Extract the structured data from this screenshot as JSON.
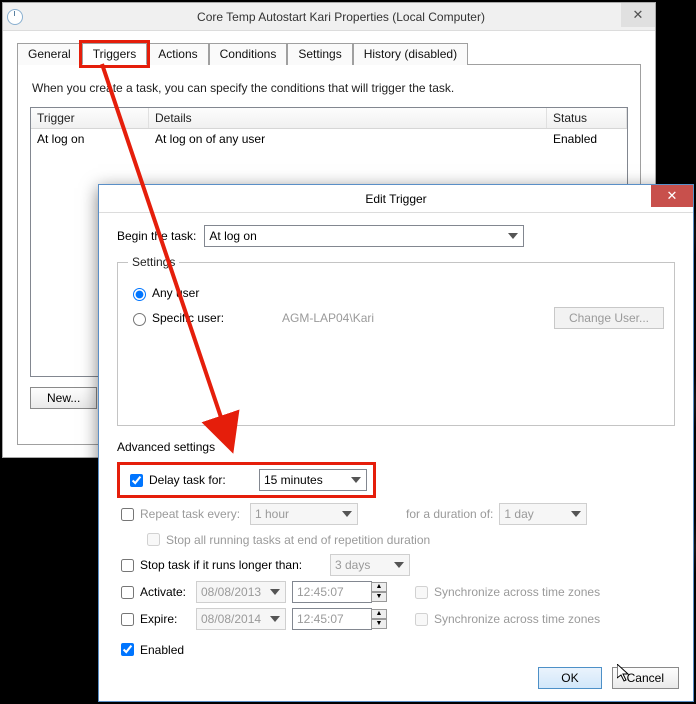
{
  "main_window": {
    "title": "Core Temp Autostart Kari Properties (Local Computer)",
    "close_glyph": "✕",
    "tabs": [
      "General",
      "Triggers",
      "Actions",
      "Conditions",
      "Settings",
      "History (disabled)"
    ],
    "active_tab_index": 1,
    "intro": "When you create a task, you can specify the conditions that will trigger the task.",
    "columns": {
      "trigger": "Trigger",
      "details": "Details",
      "status": "Status"
    },
    "rows": [
      {
        "trigger": "At log on",
        "details": "At log on of any user",
        "status": "Enabled"
      }
    ],
    "new_btn": "New..."
  },
  "edit_window": {
    "title": "Edit Trigger",
    "close_glyph": "✕",
    "begin_label": "Begin the task:",
    "begin_value": "At log on",
    "settings_legend": "Settings",
    "radio_any": "Any user",
    "radio_specific": "Specific user:",
    "specific_user": "AGM-LAP04\\Kari",
    "change_user_btn": "Change User...",
    "advanced_label": "Advanced settings",
    "delay_label": "Delay task for:",
    "delay_value": "15 minutes",
    "repeat_label": "Repeat task every:",
    "repeat_value": "1 hour",
    "repeat_duration_label": "for a duration of:",
    "repeat_duration_value": "1 day",
    "stop_running_label": "Stop all running tasks at end of repetition duration",
    "stop_longer_label": "Stop task if it runs longer than:",
    "stop_longer_value": "3 days",
    "activate_label": "Activate:",
    "activate_date": "08/08/2013",
    "activate_time": "12:45:07",
    "expire_label": "Expire:",
    "expire_date": "08/08/2014",
    "expire_time": "12:45:07",
    "sync_label": "Synchronize across time zones",
    "enabled_label": "Enabled",
    "ok_btn": "OK",
    "cancel_btn": "Cancel"
  }
}
